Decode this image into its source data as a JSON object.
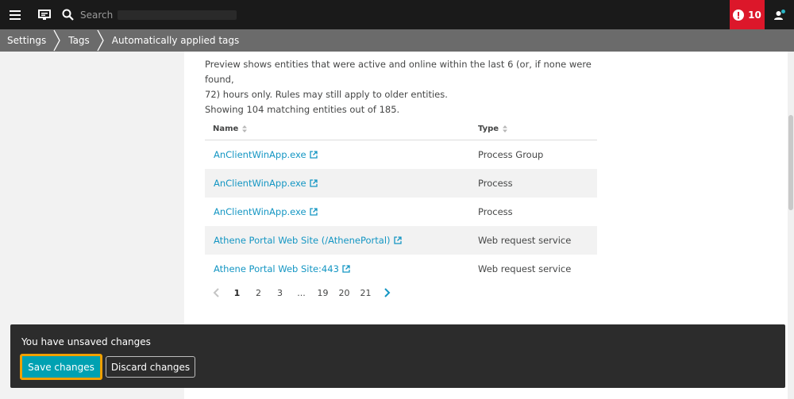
{
  "topbar": {
    "search_placeholder": "Search",
    "alert_count": "10"
  },
  "breadcrumbs": [
    {
      "label": "Settings"
    },
    {
      "label": "Tags"
    },
    {
      "label": "Automatically applied tags"
    }
  ],
  "preview": {
    "line1": "Preview shows entities that were active and online within the last 6 (or, if none were found,",
    "line2": "72) hours only. Rules may still apply to older entities.",
    "line3": "Showing 104 matching entities out of 185."
  },
  "table": {
    "headers": {
      "name": "Name",
      "type": "Type"
    },
    "rows": [
      {
        "name": "AnClientWinApp.exe",
        "type": "Process Group"
      },
      {
        "name": "AnClientWinApp.exe",
        "type": "Process"
      },
      {
        "name": "AnClientWinApp.exe",
        "type": "Process"
      },
      {
        "name": "Athene Portal Web Site (/AthenePortal)",
        "type": "Web request service"
      },
      {
        "name": "Athene Portal Web Site:443",
        "type": "Web request service"
      }
    ]
  },
  "pagination": {
    "pages": [
      "1",
      "2",
      "3",
      "...",
      "19",
      "20",
      "21"
    ],
    "current": "1"
  },
  "toast": {
    "message": "You have unsaved changes",
    "save_label": "Save changes",
    "discard_label": "Discard changes"
  },
  "colors": {
    "topbar": "#1a1a1a",
    "breadcrumb": "#6b6b6b",
    "alert": "#dc172a",
    "link": "#1496c3",
    "save_button": "#00a1b2",
    "focus_ring": "#f0a000"
  }
}
